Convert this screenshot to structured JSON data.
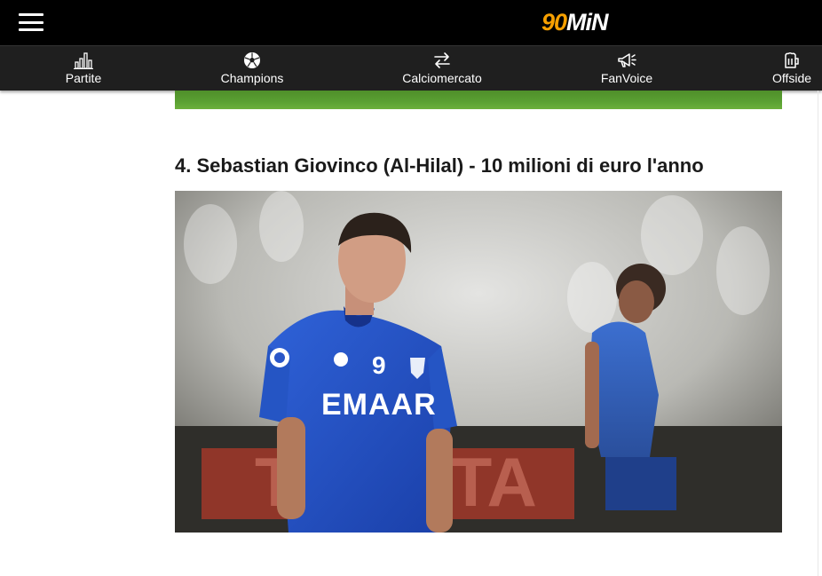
{
  "header": {
    "logo_number": "90",
    "logo_text": "MiN",
    "menu_icon": "hamburger-menu-icon",
    "colors": {
      "background": "#000000",
      "accent": "#f7a000"
    }
  },
  "nav": {
    "items": [
      {
        "label": "Partite",
        "icon": "bar-chart-icon"
      },
      {
        "label": "Champions",
        "icon": "soccer-ball-icon"
      },
      {
        "label": "Calciomercato",
        "icon": "transfer-arrows-icon"
      },
      {
        "label": "FanVoice",
        "icon": "megaphone-icon"
      },
      {
        "label": "Offside",
        "icon": "beer-mug-icon"
      }
    ]
  },
  "article": {
    "headline": "4. Sebastian Giovinco (Al-Hilal) - 10 milioni di euro l'anno",
    "photo": {
      "jersey_number": "9",
      "sponsor_text": "EMAAR",
      "board_text": "TOYOTA"
    }
  }
}
